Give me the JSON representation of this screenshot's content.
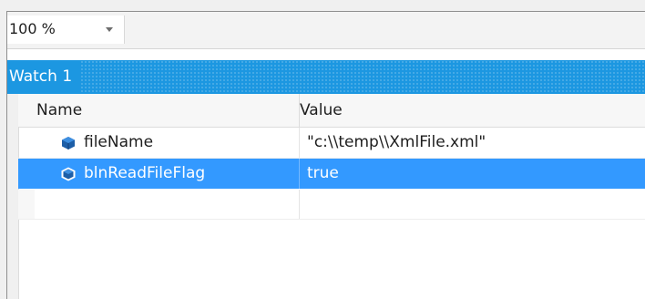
{
  "toolbar": {
    "zoom_level": "100 %"
  },
  "watch": {
    "title": "Watch 1",
    "columns": {
      "name": "Name",
      "value": "Value"
    },
    "rows": [
      {
        "name": "fileName",
        "value": "\"c:\\\\temp\\\\XmlFile.xml\"",
        "icon": "field-icon"
      },
      {
        "name": "blnReadFileFlag",
        "value": "true",
        "icon": "field-icon",
        "selected": true
      }
    ]
  },
  "colors": {
    "accent": "#1c97e1",
    "selection": "#3399ff"
  }
}
